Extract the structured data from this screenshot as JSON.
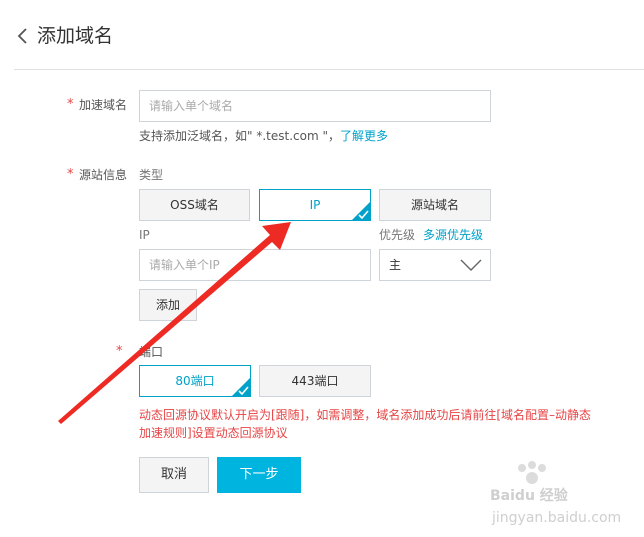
{
  "header": {
    "title": "添加域名"
  },
  "form": {
    "domain": {
      "required_mark": "*",
      "label": "加速域名",
      "placeholder": "请输入单个域名",
      "help_text": "支持添加泛域名，如\" *.test.com \"，",
      "help_link": "了解更多"
    },
    "origin": {
      "required_mark": "*",
      "label": "源站信息",
      "type_label": "类型",
      "types": [
        {
          "label": "OSS域名",
          "selected": false
        },
        {
          "label": "IP",
          "selected": true
        },
        {
          "label": "源站域名",
          "selected": false
        }
      ],
      "ip_label": "IP",
      "priority_label": "优先级",
      "priority_link": "多源优先级",
      "ip_placeholder": "请输入单个IP",
      "priority_value": "主",
      "add_button": "添加"
    },
    "port": {
      "required_mark": "*",
      "label": "端口",
      "options": [
        {
          "label": "80端口",
          "selected": true
        },
        {
          "label": "443端口",
          "selected": false
        }
      ]
    },
    "warning_line1": "动态回源协议默认开启为[跟随]，如需调整，域名添加成功后请前往[域名配置–动静态",
    "warning_line2": "加速规则]设置动态回源协议"
  },
  "actions": {
    "cancel": "取消",
    "next": "下一步"
  },
  "watermark": {
    "brand": "Baidu 经验",
    "url": "jingyan.baidu.com"
  },
  "colors": {
    "accent": "#00a2ca",
    "primary_button": "#00b4e0",
    "warning": "#e64545",
    "annotation_arrow": "#ee2a24"
  }
}
